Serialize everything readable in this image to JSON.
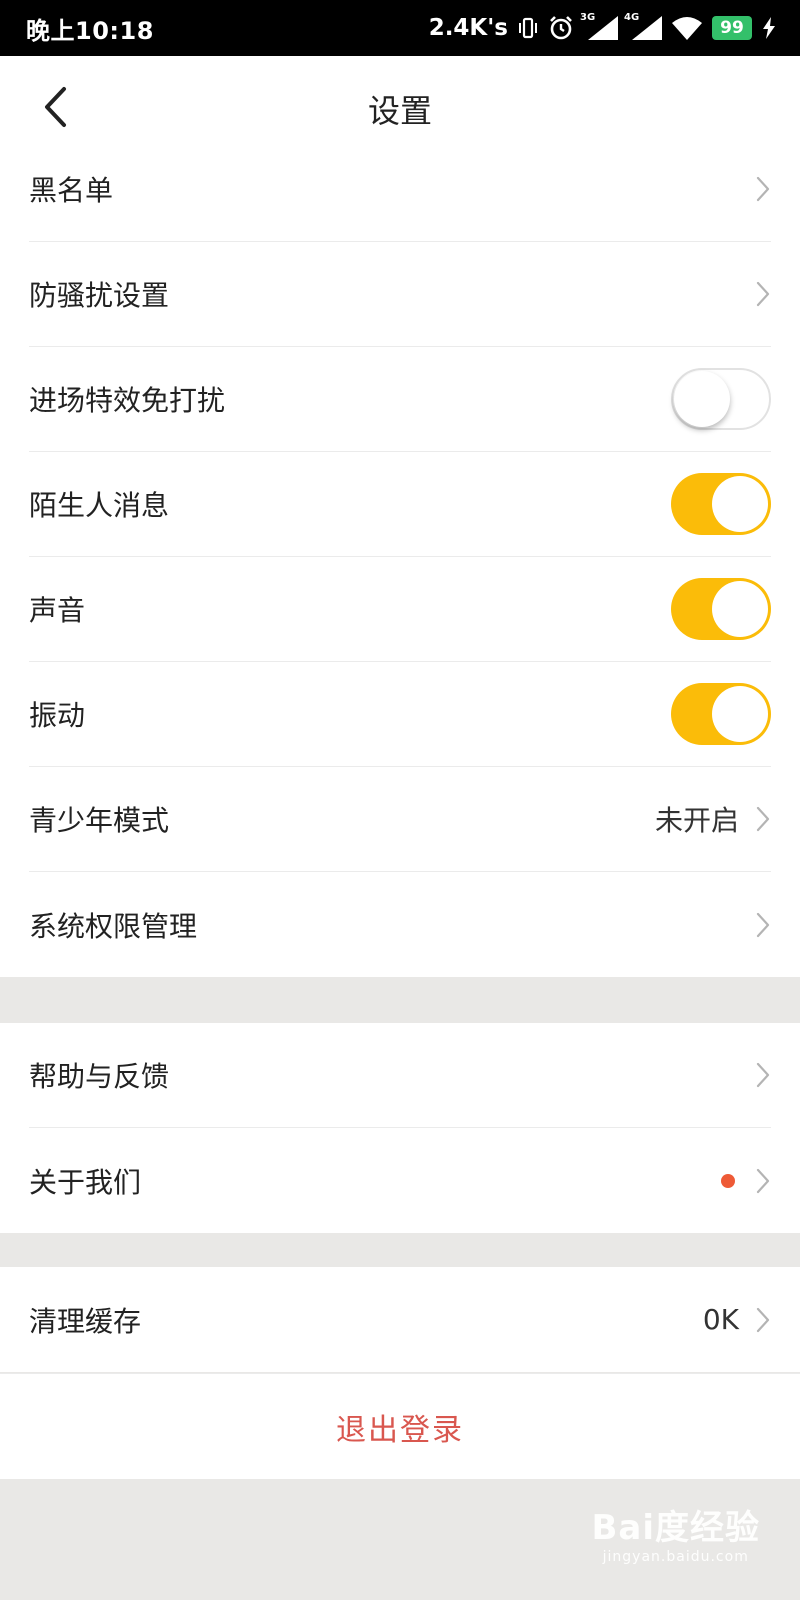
{
  "status_bar": {
    "time": "晚上10:18",
    "speed": "2.4K's",
    "net1": "3G",
    "net2": "4G",
    "battery": "99"
  },
  "header": {
    "title": "设置",
    "back_icon": "chevron-left-icon"
  },
  "group1": [
    {
      "label": "黑名单",
      "type": "link"
    },
    {
      "label": "防骚扰设置",
      "type": "link"
    },
    {
      "label": "进场特效免打扰",
      "type": "toggle",
      "on": false
    },
    {
      "label": "陌生人消息",
      "type": "toggle",
      "on": true
    },
    {
      "label": "声音",
      "type": "toggle",
      "on": true
    },
    {
      "label": "振动",
      "type": "toggle",
      "on": true
    },
    {
      "label": "青少年模式",
      "type": "link",
      "value": "未开启"
    },
    {
      "label": "系统权限管理",
      "type": "link"
    }
  ],
  "group2": [
    {
      "label": "帮助与反馈",
      "type": "link"
    },
    {
      "label": "关于我们",
      "type": "link",
      "badge": "red-dot"
    }
  ],
  "group3": [
    {
      "label": "清理缓存",
      "type": "link",
      "value": "0K"
    }
  ],
  "logout": {
    "label": "退出登录"
  },
  "watermark": {
    "main": "Bai度经验",
    "sub": "jingyan.baidu.com"
  },
  "colors": {
    "toggle_on": "#fbbc09",
    "logout_text": "#d9574f",
    "badge": "#ee5a36",
    "section_gap": "#e9e8e6"
  }
}
